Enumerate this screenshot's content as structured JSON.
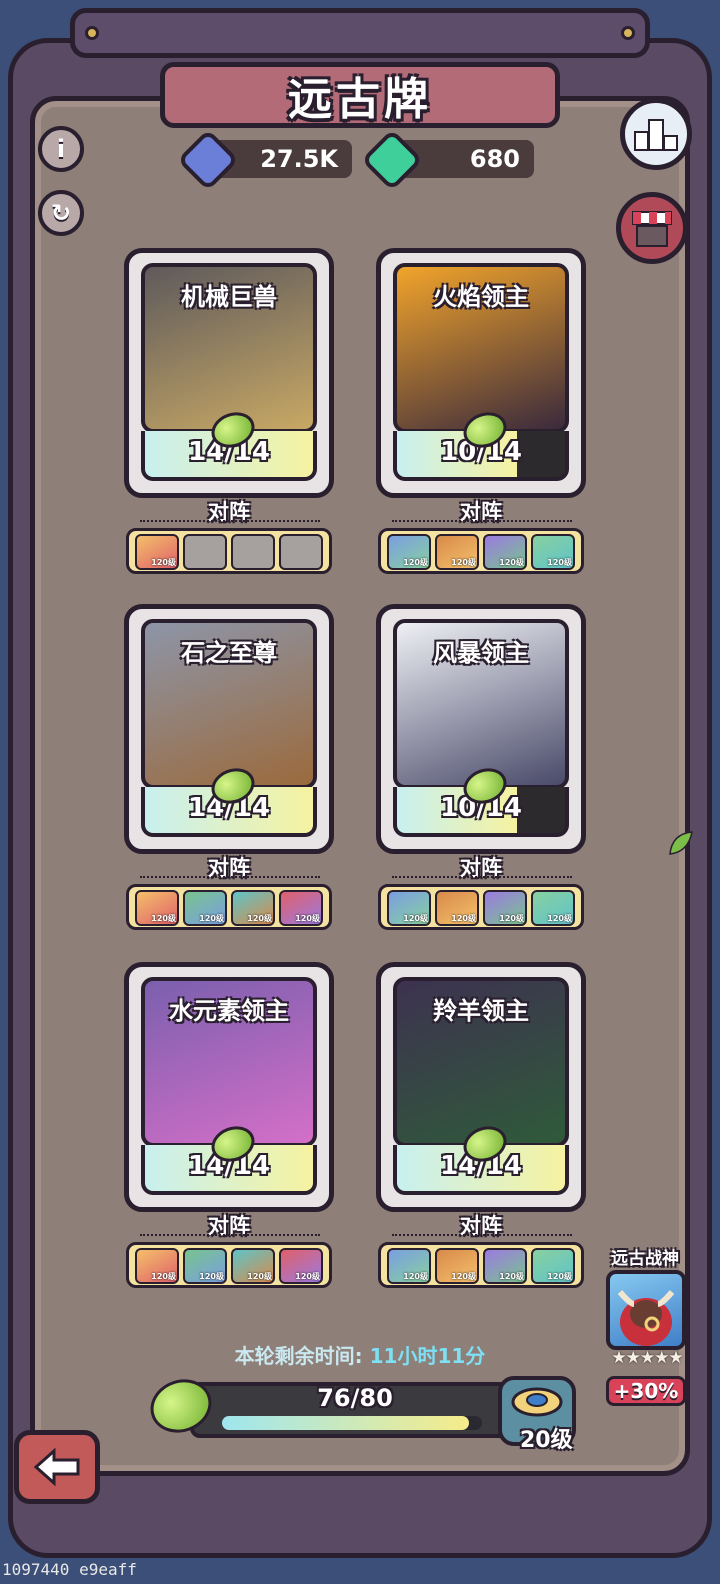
{
  "title": "远古牌",
  "resources": [
    {
      "value": "27.5K",
      "icon": "blue-gem-icon",
      "color": "#6c7fd8"
    },
    {
      "value": "680",
      "icon": "green-gem-icon",
      "color": "#3fcf9a"
    }
  ],
  "cards": [
    {
      "name": "机械巨兽",
      "progress_text": "14/14",
      "progress": 1.0,
      "lineup_label": "对阵",
      "art_colors": [
        "#5e5a5c",
        "#c8a864"
      ],
      "heroes": [
        "filled",
        "empty",
        "empty",
        "empty"
      ],
      "hero_level": "120级"
    },
    {
      "name": "火焰领主",
      "progress_text": "10/14",
      "progress": 0.714,
      "lineup_label": "对阵",
      "art_colors": [
        "#f2a42b",
        "#3a2a3c"
      ],
      "heroes": [
        "filled",
        "filled",
        "filled",
        "filled"
      ],
      "hero_level": "120级"
    },
    {
      "name": "石之至尊",
      "progress_text": "14/14",
      "progress": 1.0,
      "lineup_label": "对阵",
      "art_colors": [
        "#8d95a8",
        "#9b6a3c"
      ],
      "heroes": [
        "filled",
        "filled",
        "filled",
        "filled"
      ],
      "hero_level": "120级"
    },
    {
      "name": "风暴领主",
      "progress_text": "10/14",
      "progress": 0.714,
      "lineup_label": "对阵",
      "art_colors": [
        "#eef0f4",
        "#4a4a6a"
      ],
      "heroes": [
        "filled",
        "filled",
        "filled",
        "filled"
      ],
      "hero_level": "120级"
    },
    {
      "name": "水元素领主",
      "progress_text": "14/14",
      "progress": 1.0,
      "lineup_label": "对阵",
      "art_colors": [
        "#7b5fae",
        "#d46fc8"
      ],
      "heroes": [
        "filled",
        "filled",
        "filled",
        "filled"
      ],
      "hero_level": "120级"
    },
    {
      "name": "羚羊领主",
      "progress_text": "14/14",
      "progress": 1.0,
      "lineup_label": "对阵",
      "art_colors": [
        "#3d3250",
        "#2f5a3a"
      ],
      "heroes": [
        "filled",
        "filled",
        "filled",
        "filled"
      ],
      "hero_level": "120级"
    }
  ],
  "timer": {
    "label": "本轮剩余时间:",
    "value": "11小时11分"
  },
  "xp": {
    "text": "76/80",
    "progress": 0.95,
    "level": "20级"
  },
  "god": {
    "label": "远古战神",
    "stars": "★★★★★",
    "bonus": "+30%"
  },
  "watermark": "1097440 e9eaff"
}
